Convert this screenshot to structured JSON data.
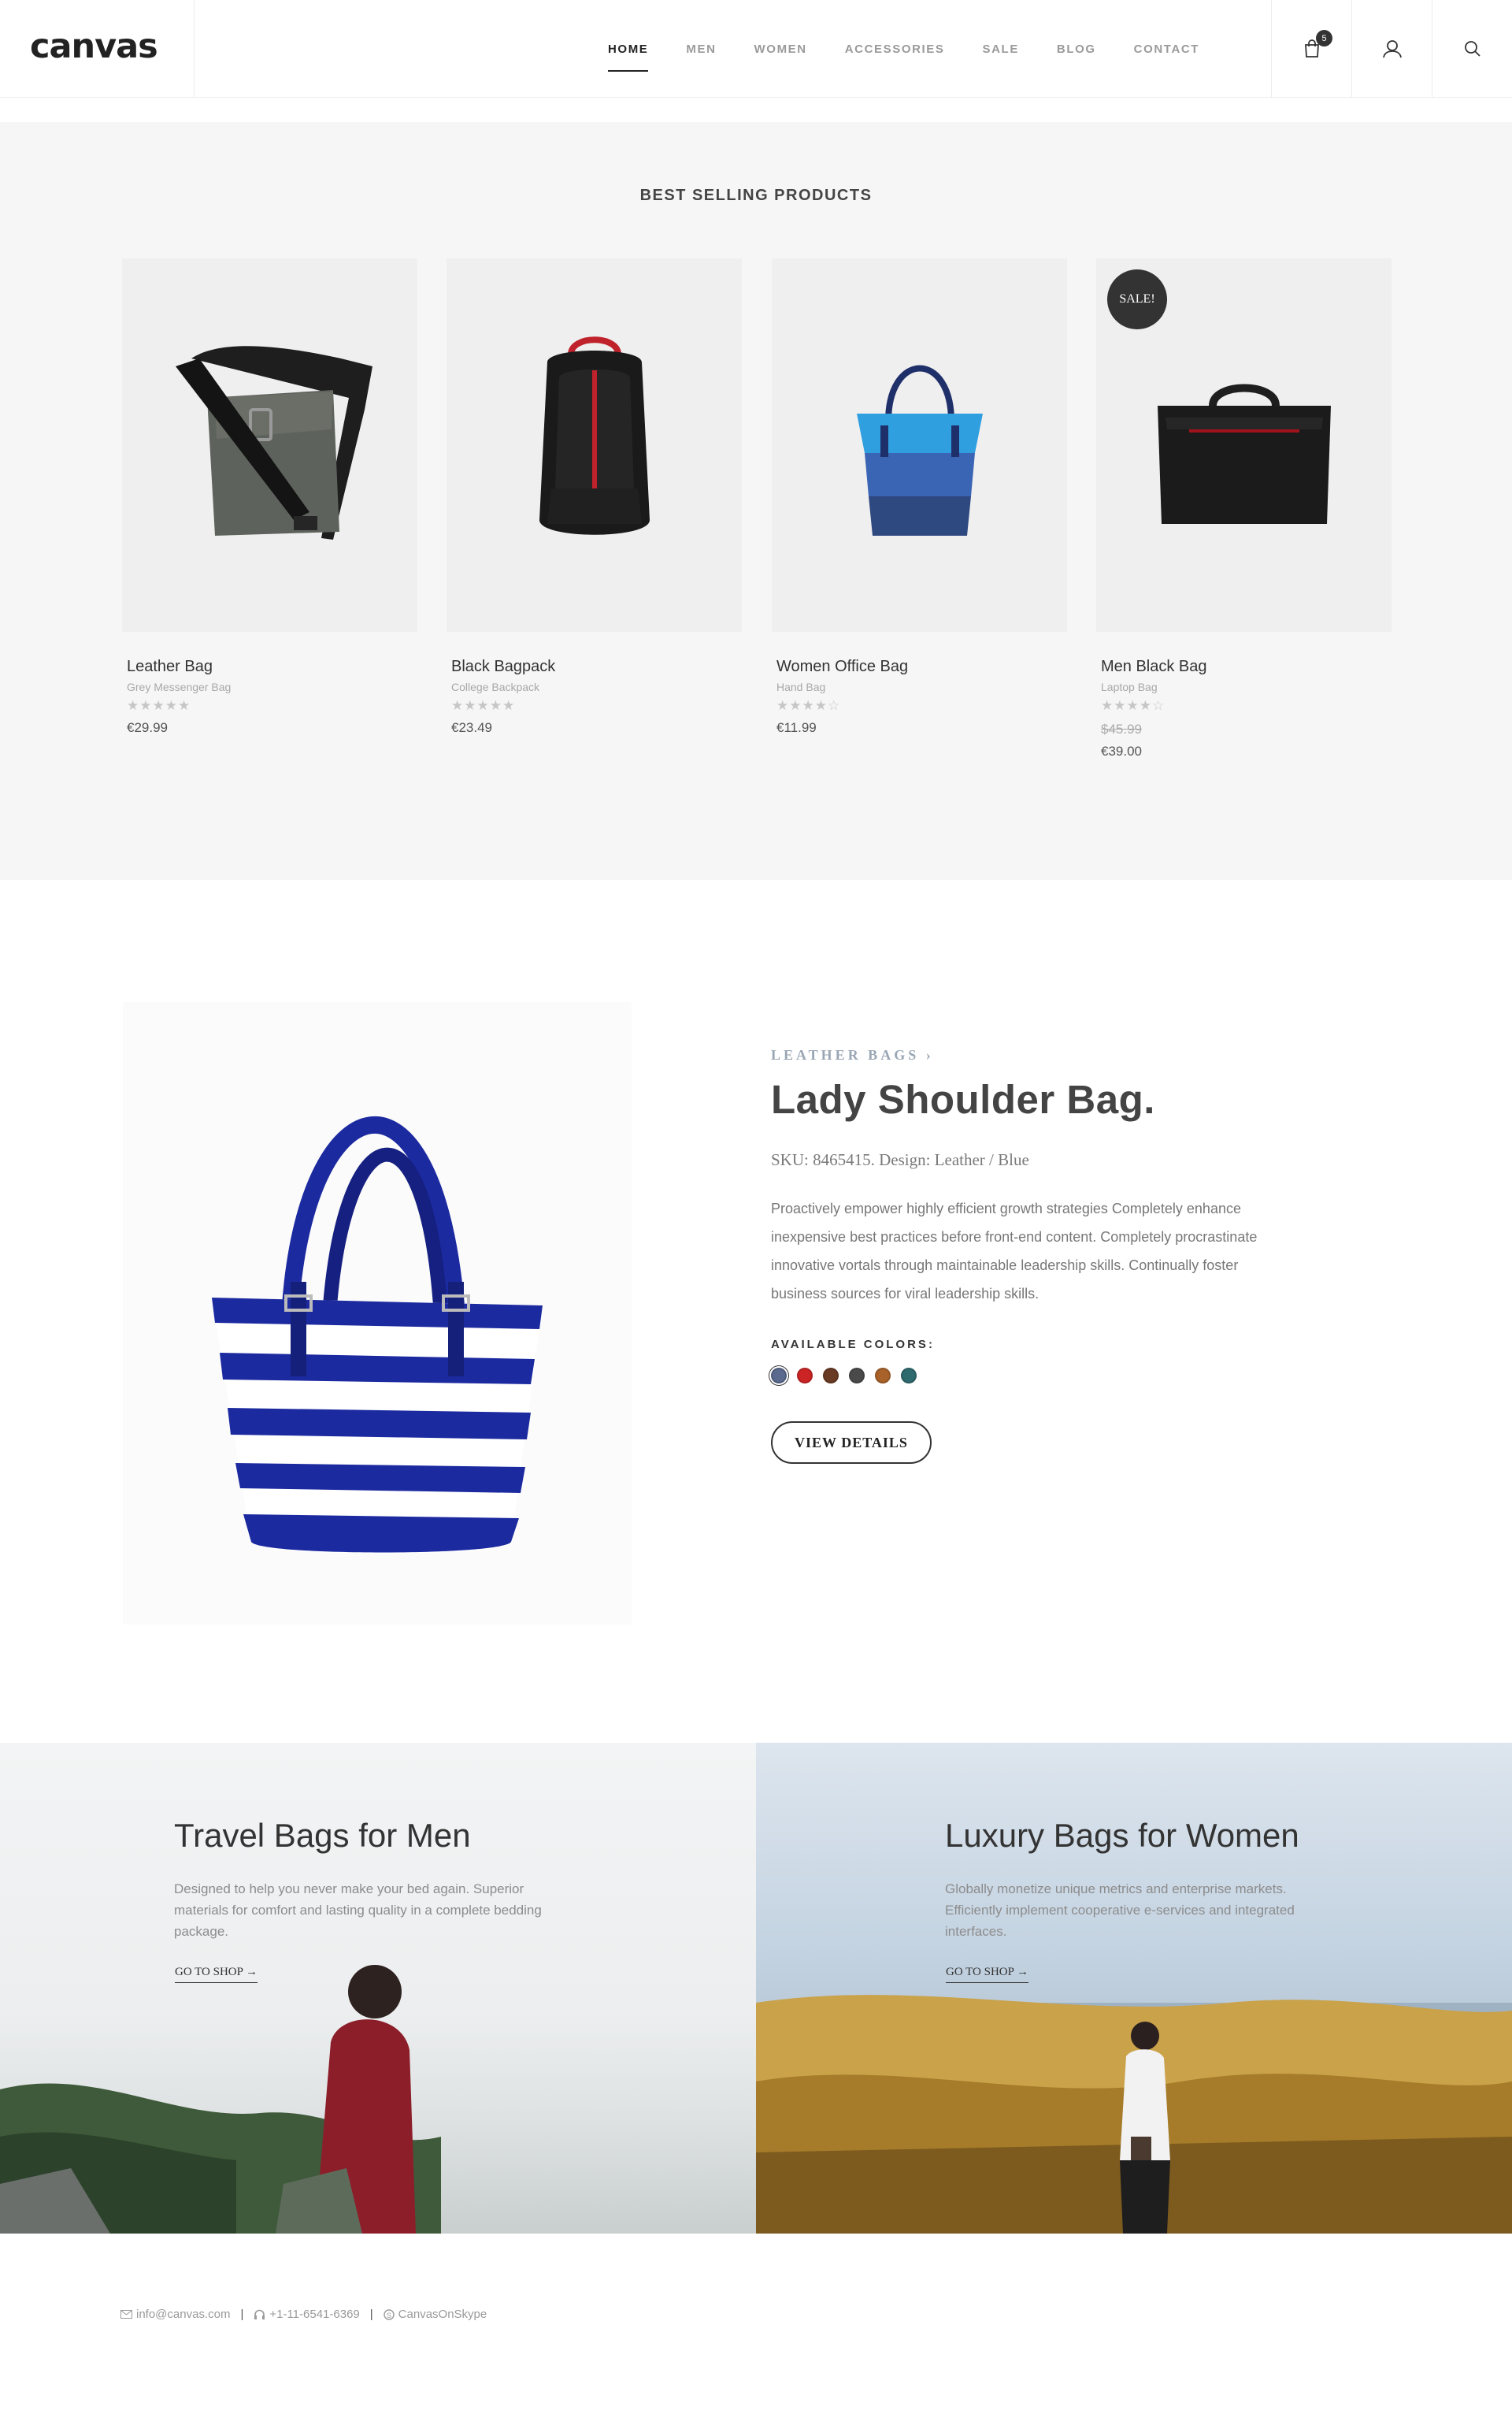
{
  "header": {
    "logo": "canvas",
    "nav": [
      "HOME",
      "MEN",
      "WOMEN",
      "ACCESSORIES",
      "SALE",
      "BLOG",
      "CONTACT"
    ],
    "cart_count": "5"
  },
  "best_selling": {
    "title": "BEST SELLING PRODUCTS",
    "products": [
      {
        "name": "Leather Bag",
        "subtitle": "Grey Messenger Bag",
        "rating": 0,
        "price": "€29.99",
        "image": "grey-messenger-bag"
      },
      {
        "name": "Black Bagpack",
        "subtitle": "College Backpack",
        "rating": 0,
        "price": "€23.49",
        "image": "black-backpack"
      },
      {
        "name": "Women Office Bag",
        "subtitle": "Hand Bag",
        "rating": 4,
        "price": "€11.99",
        "image": "blue-tote-bag"
      },
      {
        "name": "Men Black Bag",
        "subtitle": "Laptop Bag",
        "rating": 4.5,
        "old_price": "$45.99",
        "price": "€39.00",
        "badge": "SALE!",
        "image": "black-laptop-bag"
      }
    ]
  },
  "featured": {
    "category": "LEATHER BAGS ›",
    "title": "Lady Shoulder Bag.",
    "sku": "SKU: 8465415. Design: Leather / Blue",
    "description": "Proactively empower highly efficient growth strategies Completely enhance inexpensive best practices before front-end content. Completely procrastinate innovative vortals through maintainable leadership skills. Continually foster business sources for viral leadership skills.",
    "colors_label": "AVAILABLE COLORS:",
    "colors": [
      "#5a6a8e",
      "#cc2424",
      "#6a3b24",
      "#4a4a4a",
      "#a8622a",
      "#2f6a6e"
    ],
    "button": "VIEW DETAILS"
  },
  "promos": [
    {
      "title": "Travel Bags for Men",
      "description": "Designed to help you never make your bed again. Superior materials for comfort and lasting quality in a complete bedding package.",
      "link": "GO TO SHOP →"
    },
    {
      "title": "Luxury Bags for Women",
      "description": "Globally monetize unique metrics and enterprise markets. Efficiently implement cooperative e-services and integrated interfaces.",
      "link": "GO TO SHOP →"
    }
  ],
  "footer": {
    "email": "info@canvas.com",
    "phone": "+1-11-6541-6369",
    "skype": "CanvasOnSkype"
  }
}
